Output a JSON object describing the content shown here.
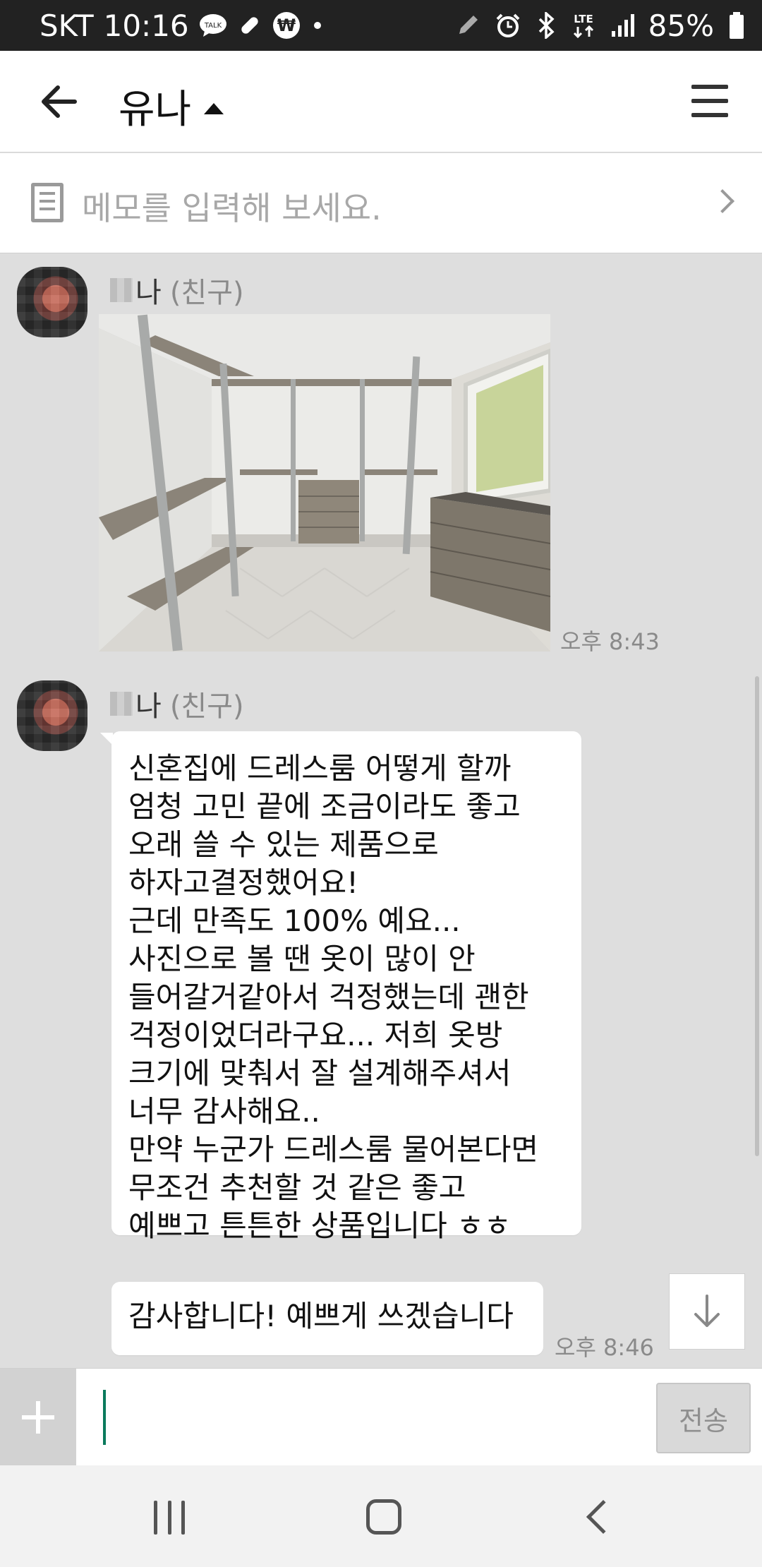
{
  "status_bar": {
    "carrier": "SKT",
    "time": "10:16",
    "battery": "85%",
    "network": "LTE",
    "icons": [
      "talk-icon",
      "link-icon",
      "won-icon",
      "dot-icon",
      "pen-icon",
      "alarm-icon",
      "bluetooth-icon",
      "lte-icon",
      "signal-icon",
      "battery-icon"
    ]
  },
  "header": {
    "title": "유나"
  },
  "memo": {
    "placeholder": "메모를 입력해 보세요."
  },
  "messages": [
    {
      "sender_suffix": "나",
      "sender_tag": "(친구)",
      "type": "photo",
      "time": "오후 8:43"
    },
    {
      "sender_suffix": "나",
      "sender_tag": "(친구)",
      "type": "text",
      "text": "신혼집에 드레스룸 어떻게 할까\n엄청 고민 끝에 조금이라도 좋고\n오래 쓸 수 있는 제품으로\n하자고결정했어요!\n근데 만족도 100% 예요...\n사진으로 볼 땐 옷이 많이 안\n들어갈거같아서 걱정했는데 괜한\n걱정이었더라구요... 저희 옷방\n크기에 맞춰서 잘 설계해주셔서\n너무 감사해요..\n만약 누군가 드레스룸 물어본다면\n무조건 추천할 것 같은 좋고\n예쁘고 튼튼한 상품입니다 ㅎㅎ"
    },
    {
      "type": "text",
      "text": "감사합니다! 예쁘게 쓰겠습니다",
      "time": "오후 8:46"
    }
  ],
  "input": {
    "placeholder": "",
    "send_label": "전송"
  },
  "colors": {
    "chat_background": "#dedede",
    "cursor": "#0a7a5c",
    "status_bar": "#222222"
  }
}
